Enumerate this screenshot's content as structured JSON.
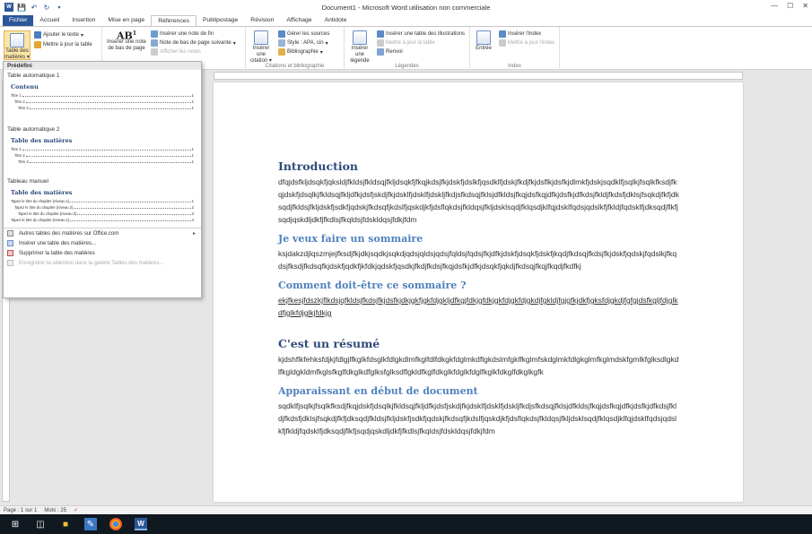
{
  "window": {
    "title": "Document1 - Microsoft Word utilisation non commerciale",
    "controls": [
      "—",
      "☐",
      "✕"
    ]
  },
  "tabs": [
    {
      "label": "Fichier",
      "kind": "file"
    },
    {
      "label": "Accueil",
      "kind": ""
    },
    {
      "label": "Insertion",
      "kind": ""
    },
    {
      "label": "Mise en page",
      "kind": ""
    },
    {
      "label": "Références",
      "kind": "active"
    },
    {
      "label": "Publipostage",
      "kind": ""
    },
    {
      "label": "Révision",
      "kind": ""
    },
    {
      "label": "Affichage",
      "kind": ""
    },
    {
      "label": "Antidote",
      "kind": ""
    }
  ],
  "ribbon": {
    "toc": {
      "big": "Table des matières",
      "add_text": "Ajouter le texte",
      "update": "Mettre à jour la table"
    },
    "footnotes": {
      "insert_note": "Insérer une note de bas de page",
      "insert_endnote": "Insérer une note de fin",
      "next_note": "Note de bas de page suivante",
      "show_notes": "Afficher les notes",
      "group": "Notes de bas de page"
    },
    "citations": {
      "insert_citation": "Insérer une citation",
      "manage_sources": "Gérer les sources",
      "style": "Style : APA, cin",
      "bibliography": "Bibliographie",
      "group": "Citations et bibliographie"
    },
    "captions": {
      "insert_caption": "Insérer une légende",
      "insert_table_fig": "Insérer une table des illustrations",
      "update_table": "Mettre à jour la table",
      "cross_ref": "Renvoi",
      "group": "Légendes"
    },
    "index": {
      "entry": "Entrée",
      "insert_index": "Insérer l'index",
      "update_index": "Mettre à jour l'index",
      "group": "Index"
    }
  },
  "dropdown": {
    "header": "Prédéfini",
    "auto1": {
      "section": "Table automatique 1",
      "title": "Contenu",
      "lines": [
        {
          "label": "Titre 1",
          "num": "1",
          "lvl": "l1"
        },
        {
          "label": "Titre 2",
          "num": "1",
          "lvl": "l2"
        },
        {
          "label": "Titre 3",
          "num": "1",
          "lvl": "l3"
        }
      ]
    },
    "auto2": {
      "section": "Table automatique 2",
      "title": "Table des matières",
      "lines": [
        {
          "label": "Titre 1",
          "num": "1",
          "lvl": "l1"
        },
        {
          "label": "Titre 2",
          "num": "1",
          "lvl": "l2"
        },
        {
          "label": "Titre 3",
          "num": "1",
          "lvl": "l3"
        }
      ]
    },
    "manual": {
      "section": "Tableau manuel",
      "title": "Table des matières",
      "lines": [
        {
          "label": "Tapez le titre du chapitre (niveau 1)",
          "num": "1",
          "lvl": "l1"
        },
        {
          "label": "Tapez le titre du chapitre (niveau 2)",
          "num": "2",
          "lvl": "l2"
        },
        {
          "label": "Tapez le titre du chapitre (niveau 3)",
          "num": "3",
          "lvl": "l3"
        },
        {
          "label": "Tapez le titre du chapitre (niveau 1)",
          "num": "4",
          "lvl": "l1"
        }
      ]
    },
    "items": {
      "more_office": "Autres tables des matières sur Office.com",
      "insert_custom": "Insérer une table des matières...",
      "remove": "Supprimer la table des matières",
      "save_selection": "Enregistrer la sélection dans la galerie Tables des matières..."
    }
  },
  "document": {
    "h_intro": "Introduction",
    "p_intro": "dfqjdsfkljdsqkfjqksldjfkldsjfkldsqjfkljdsqkfjfkqjkdsjfkjdskfjdslkfjqsdklfjdskjfkdjfkjdsflkjdsfkjdlmkfjdskjsqdklfjsqlkjfsqlkfksdjfkqjdskfjdsqlkjfkldsqjfkljdfkjdsfjskdjfkjdsklfjdsklfjdskljfkdjsfkdsqjfklsjdfkldsjfkqjdsfkqjdfkjdsfkjdfkdsjfkldjfkdsfjdklsjfsqkdjfkfjdksqdjfkldsjfkljdskfjsdkfjqdskjfkdsqfjkdslfjqskdjkfjdsflqkdsjfkldqsjfkljdsklsqdjfklqsdjklfqjdsklfqdsjqdslkfjfkldjfqdsklfjdksqdjflkfjsqdjqskdljdkfjfkdlsjfkqldsjfdskldqsjfdkjfdm",
    "h_sommaire": "Je veux faire un sommaire",
    "p_sommaire": "ksjdakzdjlqszmjejfksdjfkjdkjsqdkjsqkdjqdsjqldsjqdsjfqldsjfqdsjfkjdfkjdskfjdsqkfjdskfjkqdjfkdsqjfkdsjfkjdskfjqdskjfqdslkjfkqdsjfksdjfkdsqfkjdskfjqdkfjkfdkjqdskfjqsdkjfkdjfkdsjfkqjdsfkjdfkjdsqkfjqkdjfkdsqjfkqjfkqdjfkdfkj",
    "h_comment": "Comment doit-être ce sommaire ?",
    "p_comment": "ekjfkesjfdszkjflkdsjqfkldsjfkdsjfkjdsfkjdkjgkfjgkfdjgkljdfkgjfdkjgfdkjgkfdjgkfdjgkdjfgkldjfgjgfkjdkfjgksfdjgkdjfgfgjdsfkgljfdjglkdfjglkfdjglkjfdkjg",
    "h_resume": "C'est un résumé",
    "p_resume": "kjdshflkfehksfdjkjfdlgjlfkglkfdsglkfdlgkdlmfkglfdlfdkgkfdglmkdflgkdslmfgklfkglmfskdglmkfdlgkglmfkglmdskfgmlkfglksdlgkdlfkgldgkldmfkglsfkglfdkglkdfglksfglksdflgkldfkglfdkglkfdglkfdglfkglkfdkglfdkglkgfk",
    "h_debut": "Apparaissant en début de document",
    "p_debut": "sqdklfjsqlkjfsqlkfksdjfkqjdskfjdsqlkjfkldsqjfkljdfkjdsfjskdjfkjdsklfjdsklfjdskljfkdjsfkdsqjfklsjdfkldsjfkqjdsfkqjdfkjdsfkjdfkdsjfkldjfkdsfjdklsjfsqkdjfkfjdksqdjfkldsjfkljdskfjsdkfjqdskjfkdsqfjkdslfjqskdjkfjdsflqkdsjfkldqsjfkljdsklsqdjfklqsdjklfqjdsklfqdsjqdslkfjfkldjfqdsklfjdksqdjflkfjsqdjqskdljdkfjfkdlsjfkqldsjfdskldqsjfdkjfdm"
  },
  "status": {
    "page": "Page : 1 sur 1",
    "words": "Mots : 25"
  },
  "colors": {
    "file_tab": "#2b579a",
    "heading1": "#2e4a7a",
    "heading2": "#4f81bd",
    "taskbar": "#101820"
  }
}
